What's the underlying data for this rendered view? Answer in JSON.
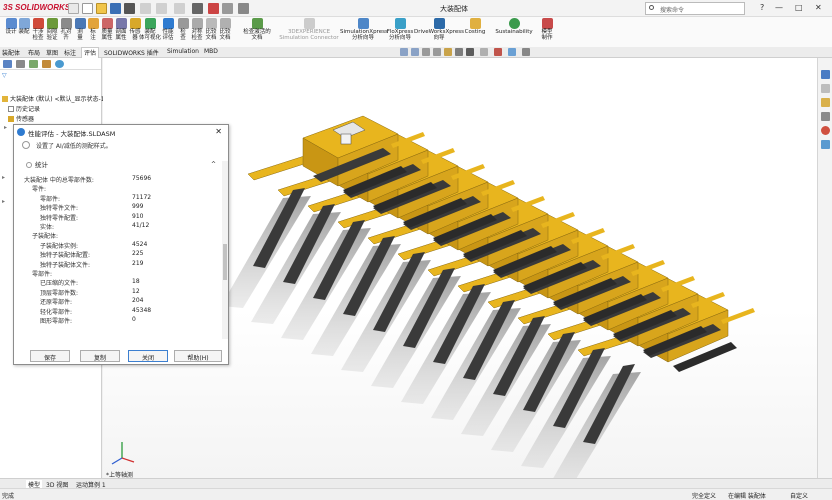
{
  "app": {
    "title": "大装配体",
    "search_placeholder": "搜索命令",
    "window_controls": {
      "minimize": "—",
      "restore": "□",
      "close": "✕"
    }
  },
  "ribbon": {
    "buttons": [
      {
        "label1": "设计",
        "label2": ""
      },
      {
        "label1": "装配",
        "label2": ""
      },
      {
        "label1": "干涉",
        "label2": "检查"
      },
      {
        "label1": "间隙",
        "label2": "验证"
      },
      {
        "label1": "孔对",
        "label2": "齐"
      },
      {
        "label1": "测",
        "label2": "量"
      },
      {
        "label1": "标",
        "label2": "注"
      },
      {
        "label1": "质量",
        "label2": "属性"
      },
      {
        "label1": "剖面",
        "label2": "属性"
      },
      {
        "label1": "传感",
        "label2": "器"
      },
      {
        "label1": "装配",
        "label2": "体可视化"
      },
      {
        "label1": "性能",
        "label2": "评估"
      },
      {
        "label1": "检",
        "label2": "查"
      },
      {
        "label1": "对称",
        "label2": "检查"
      },
      {
        "label1": "比较",
        "label2": "文档"
      },
      {
        "label1": "比较",
        "label2": "文档"
      },
      {
        "label1": "检查激活的",
        "label2": "文档"
      }
    ],
    "wide_buttons": [
      {
        "label1": "3DEXPERIENCE",
        "label2": "Simulation Connector"
      },
      {
        "label1": "SimulationXpress",
        "label2": "分析向导"
      },
      {
        "label1": "FloXpress",
        "label2": "分析向导"
      },
      {
        "label1": "DriveWorksXpress",
        "label2": "向导"
      },
      {
        "label1": "Costing",
        "label2": ""
      },
      {
        "label1": "Sustainability",
        "label2": ""
      },
      {
        "label1": "模型",
        "label2": "制作"
      }
    ]
  },
  "command_tabs": [
    "装配体",
    "布局",
    "草图",
    "标注",
    "评估",
    "SOLIDWORKS 插件",
    "Simulation",
    "MBD"
  ],
  "command_tab_active": "评估",
  "feature_tree": {
    "filter_icon": "filter-icon",
    "root": "大装配体 (默认) <默认_显示状态-1>",
    "rows": [
      "历史记录",
      "传感器"
    ]
  },
  "dialog": {
    "title": "性能评估 - 大装配体.SLDASM",
    "subtitle": "设置了 AI/减低的测配样式。",
    "section": "统计",
    "section_caret": "^",
    "stats": [
      {
        "label": "大装配体 中的总零部件数:",
        "value": "75696",
        "indent": 0
      },
      {
        "label": "零件:",
        "value": "",
        "indent": 1
      },
      {
        "label": "零部件:",
        "value": "71172",
        "indent": 2
      },
      {
        "label": "独特零件文件:",
        "value": "999",
        "indent": 2
      },
      {
        "label": "独特零件配置:",
        "value": "910",
        "indent": 2
      },
      {
        "label": "实体:",
        "value": "41/12",
        "indent": 2
      },
      {
        "label": "子装配体:",
        "value": "",
        "indent": 1
      },
      {
        "label": "子装配体实例:",
        "value": "4524",
        "indent": 2
      },
      {
        "label": "独特子装配体配置:",
        "value": "225",
        "indent": 2
      },
      {
        "label": "独特子装配体文件:",
        "value": "219",
        "indent": 2
      },
      {
        "label": "零部件:",
        "value": "",
        "indent": 1
      },
      {
        "label": "已压缩的文件:",
        "value": "18",
        "indent": 2
      },
      {
        "label": "顶层零部件数:",
        "value": "12",
        "indent": 2
      },
      {
        "label": "还原零部件:",
        "value": "204",
        "indent": 2
      },
      {
        "label": "轻化零部件:",
        "value": "45348",
        "indent": 2
      },
      {
        "label": "图形零部件:",
        "value": "0",
        "indent": 2
      }
    ],
    "buttons": [
      "保存",
      "复制",
      "关闭",
      "帮助(H)"
    ]
  },
  "bottom_tabs": [
    "模型",
    "3D 视图",
    "运动算例 1"
  ],
  "status": {
    "left": "完成",
    "right1": "完全定义",
    "right2": "在编辑 装配体",
    "right3": "自定义"
  },
  "colors": {
    "machine_yellow": "#e8b51e",
    "machine_dark": "#3a3a3a",
    "brand_red": "#c8102e",
    "accent_blue": "#2f7bd0"
  }
}
